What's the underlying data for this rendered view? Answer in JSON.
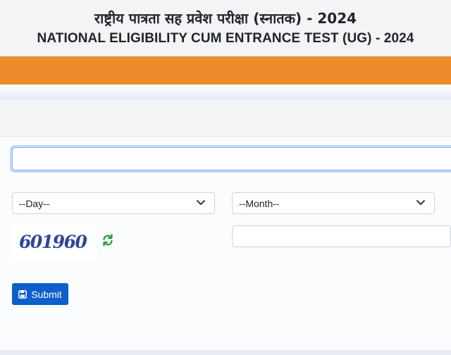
{
  "header": {
    "title_hindi": "राष्ट्रीय पात्रता सह प्रवेश परीक्षा (स्नातक) - 2024",
    "title_english": "NATIONAL ELIGIBILITY CUM ENTRANCE TEST (UG) - 2024"
  },
  "colors": {
    "accent_band": "#ee8c2d",
    "primary_button": "#0d5fc9",
    "captcha_text": "#2e4597",
    "refresh_icon": "#1f9d38"
  },
  "form": {
    "application_number": {
      "value": ""
    },
    "dob_day": {
      "selected": "--Day--"
    },
    "dob_month": {
      "selected": "--Month--"
    },
    "captcha": {
      "text": "601960",
      "input_value": ""
    },
    "submit_label": "Submit"
  },
  "icons": {
    "select_arrow": "chevron-down-icon",
    "refresh": "refresh-icon",
    "submit": "save-icon"
  }
}
